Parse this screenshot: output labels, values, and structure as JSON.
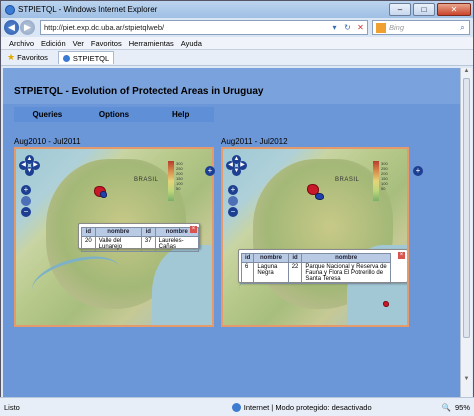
{
  "window": {
    "title": "STPIETQL - Windows Internet Explorer"
  },
  "address": {
    "url": "http://piet.exp.dc.uba.ar/stpietqlweb/",
    "search_placeholder": "Bing"
  },
  "menu": [
    "Archivo",
    "Edición",
    "Ver",
    "Favoritos",
    "Herramientas",
    "Ayuda"
  ],
  "favorites": {
    "label": "Favoritos",
    "tab_label": "STPIETQL"
  },
  "app": {
    "title": "STPIETQL - Evolution of Protected Areas in Uruguay",
    "menu": [
      "Queries",
      "Options",
      "Help"
    ]
  },
  "maps": [
    {
      "period": "Aug2010 - Jul2011",
      "country_label": "BRASIL",
      "popup": {
        "headers": [
          "id",
          "nombre",
          "id",
          "nombre"
        ],
        "rows": [
          [
            "20",
            "Valle del Lunarejo",
            "37",
            "Laureles-Cañas"
          ]
        ]
      }
    },
    {
      "period": "Aug2011 - Jul2012",
      "country_label": "BRASIL",
      "popup": {
        "headers": [
          "id",
          "nombre",
          "id",
          "nombre"
        ],
        "rows": [
          [
            "6",
            "Laguna Negra",
            "22",
            "Parque Nacional y Reserva de Fauna y Flora El Potrerillo de Santa Teresa"
          ]
        ]
      }
    }
  ],
  "legend_labels": [
    "300",
    "250",
    "200",
    "150",
    "100",
    "50"
  ],
  "status": {
    "left": "Listo",
    "zone": "Internet | Modo protegido: desactivado",
    "zoom": "95%"
  },
  "colors": {
    "page_bg": "#6b96d8",
    "map_border": "#e59a6c",
    "marker": "#c8182a",
    "nav": "#1d3f92"
  }
}
